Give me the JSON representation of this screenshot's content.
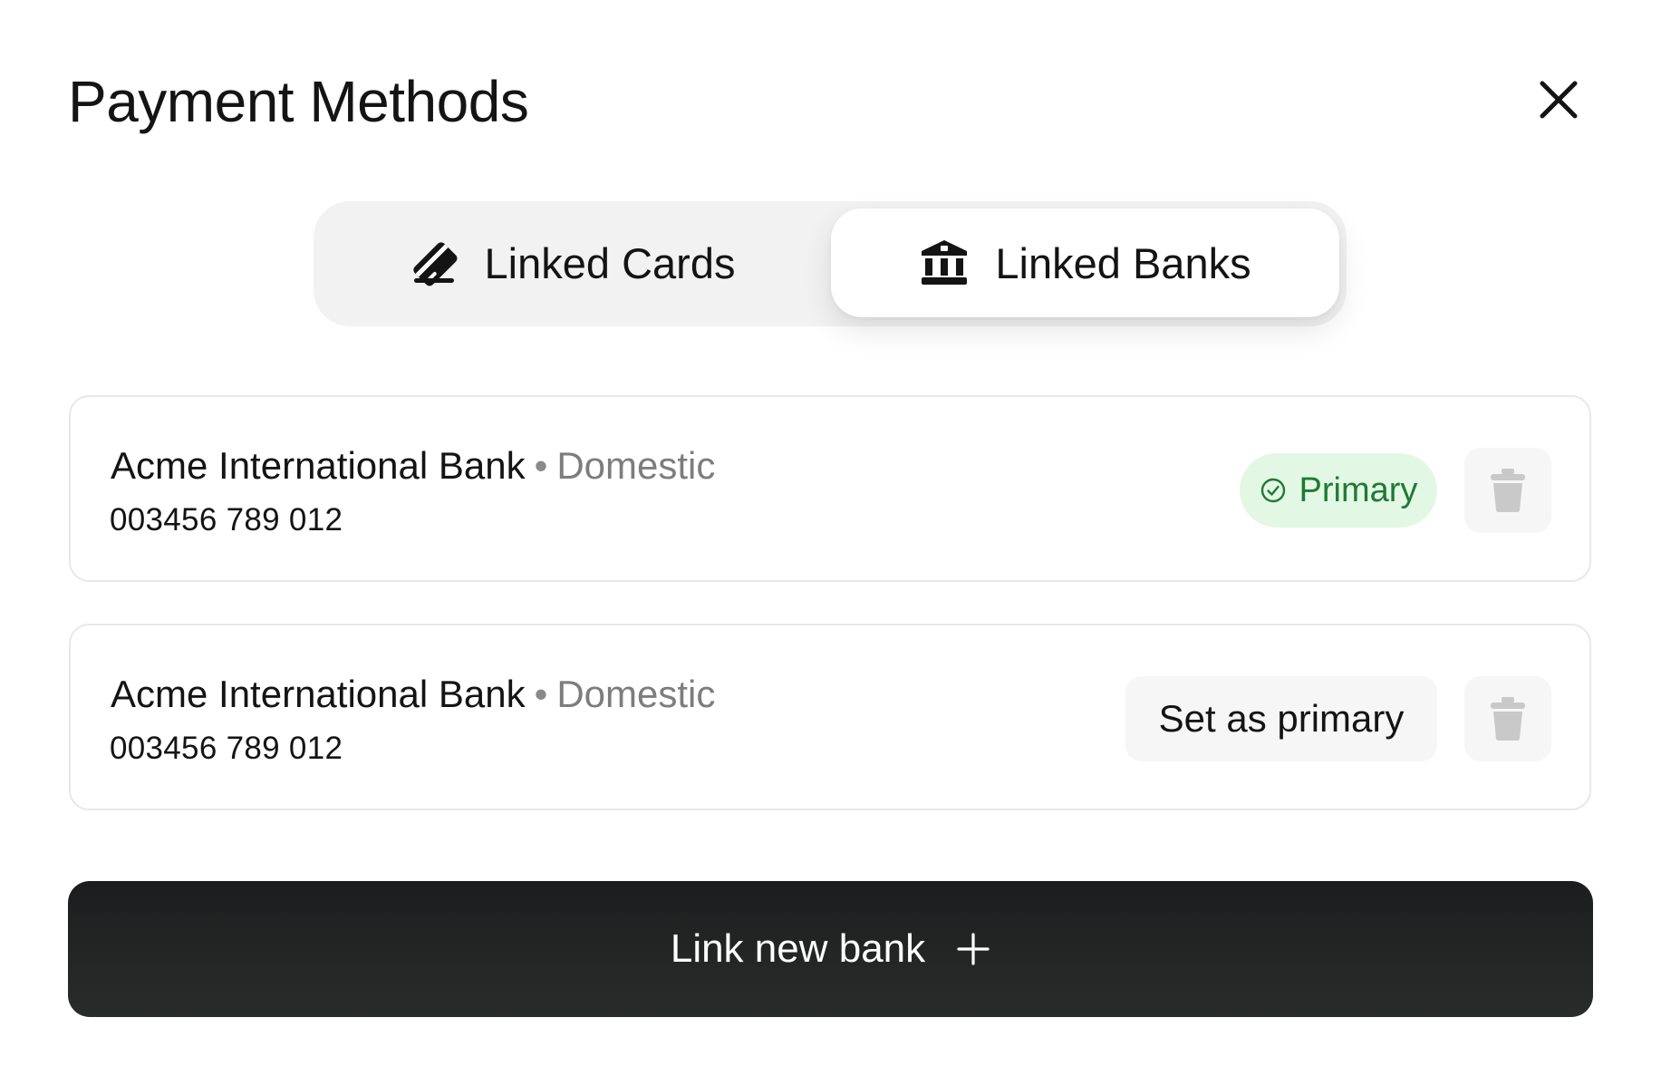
{
  "modal": {
    "title": "Payment Methods"
  },
  "tabs": [
    {
      "label": "Linked Cards",
      "icon": "credit-card-icon",
      "selected": false
    },
    {
      "label": "Linked Banks",
      "icon": "bank-icon",
      "selected": true
    }
  ],
  "banks": [
    {
      "name": "Acme International Bank",
      "separator": "•",
      "type": "Domestic",
      "account_number": "003456 789 012",
      "status_label": "Primary",
      "is_primary": true
    },
    {
      "name": "Acme International Bank",
      "separator": "•",
      "type": "Domestic",
      "account_number": "003456 789 012",
      "action_label": "Set as primary",
      "is_primary": false
    }
  ],
  "footer": {
    "link_button_label": "Link new bank",
    "link_button_icon": "plus-icon"
  },
  "colors": {
    "primary_badge_bg": "#e3f8e4",
    "primary_badge_text": "#1f7a34",
    "cta_bg": "#1c1d1e",
    "muted_text": "#7d7d7d"
  }
}
